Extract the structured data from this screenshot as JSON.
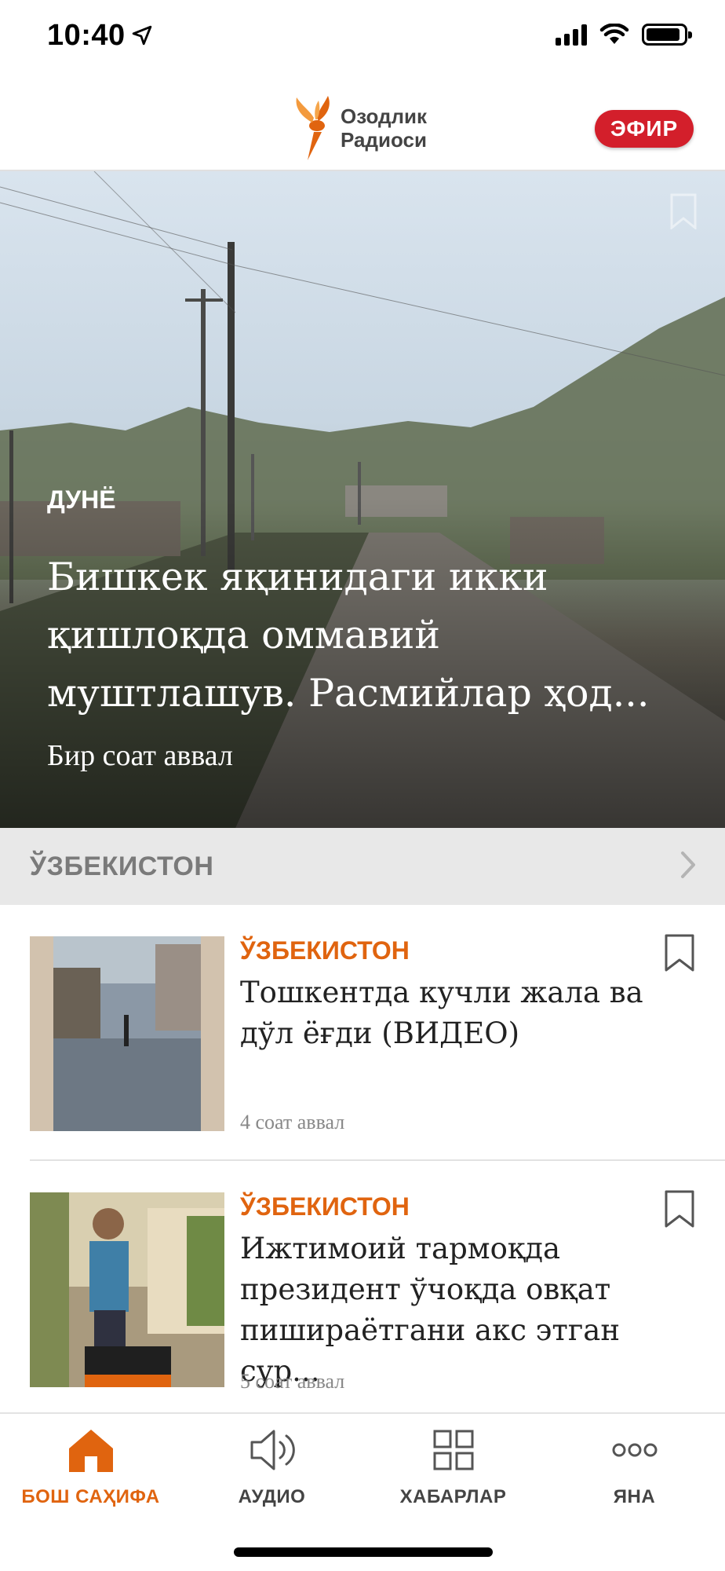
{
  "status": {
    "time": "10:40"
  },
  "header": {
    "logo_line1": "Озодлик",
    "logo_line2": "Радиоси",
    "live_label": "ЭФИР"
  },
  "hero": {
    "category": "ДУНЁ",
    "title": "Бишкек яқинидаги икки қишлоқда оммавий муштлашув. Расмийлар ҳод...",
    "time": "Бир соат аввал"
  },
  "section": {
    "title": "ЎЗБЕКИСТОН"
  },
  "articles": [
    {
      "category": "ЎЗБЕКИСТОН",
      "title": "Тошкентда кучли жала ва дўл ёғди (ВИДЕО)",
      "time": "4 соат аввал"
    },
    {
      "category": "ЎЗБЕКИСТОН",
      "title": "Ижтимоий тармоқда президент ўчоқда овқат пишираётгани акс этган сур...",
      "time": "5 соат аввал"
    }
  ],
  "tabs": [
    {
      "label": "БОШ САҲИФА",
      "icon": "home-icon",
      "active": true
    },
    {
      "label": "АУДИО",
      "icon": "speaker-icon",
      "active": false
    },
    {
      "label": "ХАБАРЛАР",
      "icon": "grid-icon",
      "active": false
    },
    {
      "label": "ЯНА",
      "icon": "more-icon",
      "active": false
    }
  ],
  "colors": {
    "accent": "#e0640f",
    "live": "#d31f2b",
    "section_bg": "#e8e8e8"
  }
}
